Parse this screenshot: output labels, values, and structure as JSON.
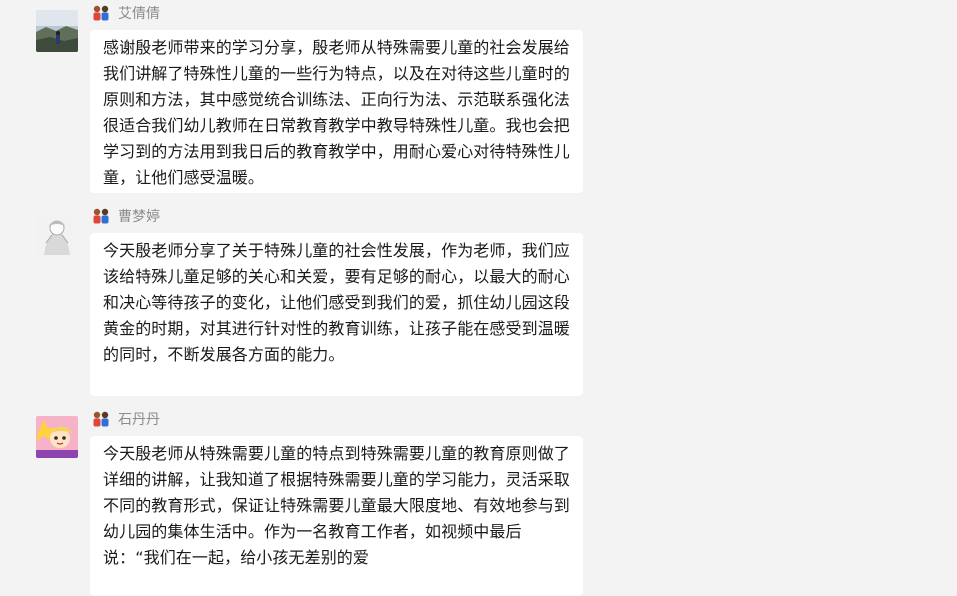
{
  "messages": [
    {
      "sender": "艾倩倩",
      "avatar_icon": "landscape-photo-avatar",
      "role_icon": "parent-teacher-icon",
      "text": "感谢殷老师带来的学习分享，殷老师从特殊需要儿童的社会发展给我们讲解了特殊性儿童的一些行为特点，以及在对待这些儿童时的原则和方法，其中感觉统合训练法、正向行为法、示范联系强化法很适合我们幼儿教师在日常教育教学中教导特殊性儿童。我也会把学习到的方法用到我日后的教育教学中，用耐心爱心对待特殊性儿童，让他们感受温暖。"
    },
    {
      "sender": "曹梦婷",
      "avatar_icon": "anime-sketch-avatar",
      "role_icon": "parent-teacher-icon",
      "text": "今天殷老师分享了关于特殊儿童的社会性发展，作为老师，我们应该给特殊儿童足够的关心和关爱，要有足够的耐心，以最大的耐心和决心等待孩子的变化，让他们感受到我们的爱，抓住幼儿园这段黄金的时期，对其进行针对性的教育训练，让孩子能在感受到温暖的同时，不断发展各方面的能力。"
    },
    {
      "sender": "石丹丹",
      "avatar_icon": "cartoon-character-avatar",
      "role_icon": "parent-teacher-icon",
      "text": "今天殷老师从特殊需要儿童的特点到特殊需要儿童的教育原则做了详细的讲解，让我知道了根据特殊需要儿童的学习能力，灵活采取不同的教育形式，保证让特殊需要儿童最大限度地、有效地参与到幼儿园的集体生活中。作为一名教育工作者，如视频中最后说：“我们在一起，给小孩无差别的爱"
    }
  ]
}
